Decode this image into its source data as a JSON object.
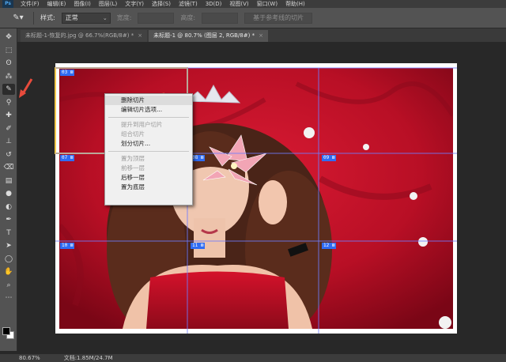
{
  "menu": {
    "logo": "Ps",
    "items": [
      "文件(F)",
      "编辑(E)",
      "图像(I)",
      "图层(L)",
      "文字(Y)",
      "选择(S)",
      "滤镜(T)",
      "3D(D)",
      "视图(V)",
      "窗口(W)",
      "帮助(H)"
    ]
  },
  "options": {
    "tool_icon": "slice-select-icon",
    "style_label": "样式:",
    "style_value": "正常",
    "width_label": "宽度:",
    "height_label": "高度:",
    "guides_button": "基于参考线的切片"
  },
  "tabs": [
    {
      "label": "未标题-1-恢复的.jpg @ 66.7%(RGB/8#) *",
      "close": "×",
      "active": false
    },
    {
      "label": "未标题-1 @ 80.7% (图层 2, RGB/8#) *",
      "close": "×",
      "active": true
    }
  ],
  "toolbox": {
    "tools": [
      {
        "name": "move-tool-icon",
        "glyph": "✥"
      },
      {
        "name": "marquee-tool-icon",
        "glyph": "⬚"
      },
      {
        "name": "lasso-tool-icon",
        "glyph": "ʘ"
      },
      {
        "name": "quick-select-tool-icon",
        "glyph": "⁂"
      },
      {
        "name": "slice-tool-icon",
        "glyph": "✎"
      },
      {
        "name": "eyedropper-tool-icon",
        "glyph": "⚲"
      },
      {
        "name": "healing-tool-icon",
        "glyph": "✚"
      },
      {
        "name": "brush-tool-icon",
        "glyph": "✐"
      },
      {
        "name": "stamp-tool-icon",
        "glyph": "⊥"
      },
      {
        "name": "history-brush-icon",
        "glyph": "↺"
      },
      {
        "name": "eraser-tool-icon",
        "glyph": "⌫"
      },
      {
        "name": "gradient-tool-icon",
        "glyph": "▤"
      },
      {
        "name": "blur-tool-icon",
        "glyph": "●"
      },
      {
        "name": "dodge-tool-icon",
        "glyph": "◐"
      },
      {
        "name": "pen-tool-icon",
        "glyph": "✒"
      },
      {
        "name": "type-tool-icon",
        "glyph": "T"
      },
      {
        "name": "path-select-tool-icon",
        "glyph": "➤"
      },
      {
        "name": "shape-tool-icon",
        "glyph": "◯"
      },
      {
        "name": "hand-tool-icon",
        "glyph": "✋"
      },
      {
        "name": "zoom-tool-icon",
        "glyph": "⌕"
      },
      {
        "name": "more-tools-icon",
        "glyph": "⋯"
      }
    ]
  },
  "slices": [
    {
      "id": "03",
      "icon": "⊠"
    },
    {
      "id": "07",
      "icon": "⊠"
    },
    {
      "id": "08",
      "icon": "⊠"
    },
    {
      "id": "09",
      "icon": "⊠"
    },
    {
      "id": "10",
      "icon": "⊠"
    },
    {
      "id": "11",
      "icon": "⊠"
    },
    {
      "id": "12",
      "icon": "⊠"
    }
  ],
  "context_menu": {
    "items": [
      {
        "label": "删除切片",
        "disabled": false,
        "highlight": true
      },
      {
        "label": "编辑切片选项...",
        "disabled": false
      },
      {
        "sep": true
      },
      {
        "label": "提升到用户切片",
        "disabled": true
      },
      {
        "label": "组合切片",
        "disabled": true
      },
      {
        "label": "划分切片...",
        "disabled": false
      },
      {
        "sep": true
      },
      {
        "label": "置为顶层",
        "disabled": true
      },
      {
        "label": "前移一层",
        "disabled": true
      },
      {
        "label": "后移一层",
        "disabled": false
      },
      {
        "label": "置为底层",
        "disabled": false
      }
    ]
  },
  "status": {
    "zoom": "80.67%",
    "doc": "文档:1.85M/24.7M"
  },
  "colors": {
    "annotation_arrow": "#e84b3c",
    "slice_badge": "#2f6cf3",
    "slice_line": "#6f7cff",
    "backdrop_red": "#c0132b"
  }
}
